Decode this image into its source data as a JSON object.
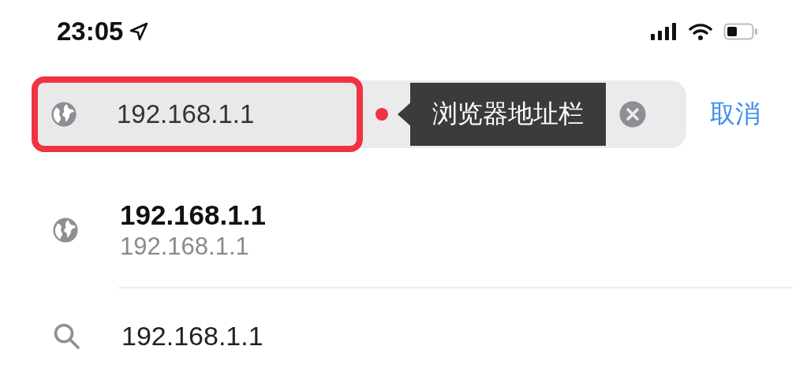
{
  "status_bar": {
    "time": "23:05"
  },
  "address_bar": {
    "value": "192.168.1.1",
    "callout": "浏览器地址栏"
  },
  "cancel_button": "取消",
  "suggestions": [
    {
      "kind": "site",
      "title": "192.168.1.1",
      "subtitle": "192.168.1.1"
    },
    {
      "kind": "search",
      "title": "192.168.1.1"
    }
  ]
}
